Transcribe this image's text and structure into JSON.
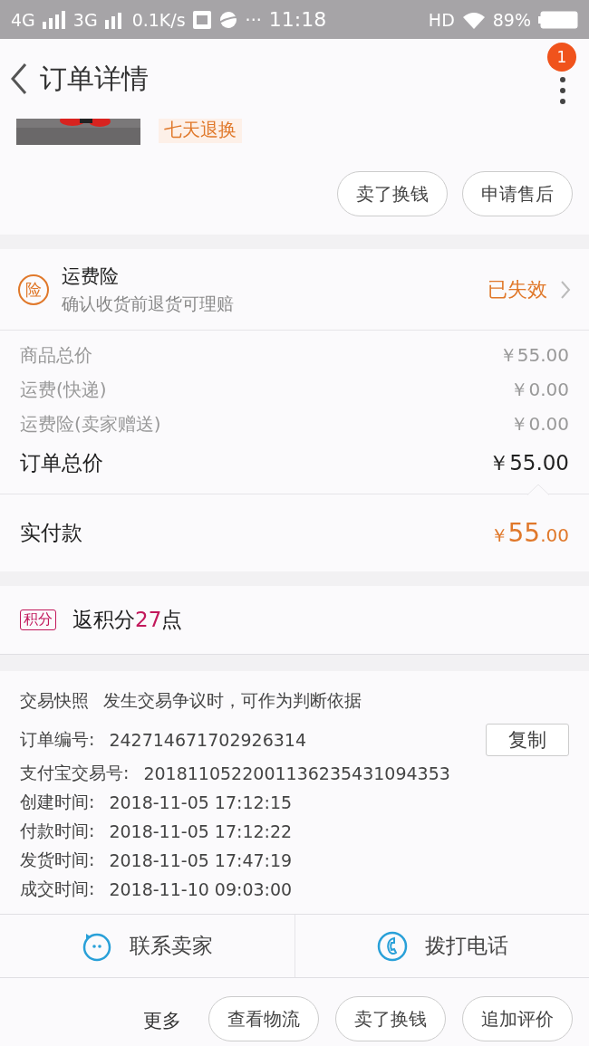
{
  "status_bar": {
    "network_1": "4G",
    "network_2": "3G",
    "speed": "0.1K/s",
    "more": "···",
    "time": "11:18",
    "hd": "HD",
    "battery": "89%"
  },
  "header": {
    "title": "订单详情",
    "badge": "1"
  },
  "product": {
    "tag": "七天退换"
  },
  "product_buttons": [
    "卖了换钱",
    "申请售后"
  ],
  "insurance": {
    "badge": "险",
    "title": "运费险",
    "subtitle": "确认收货前退货可理赔",
    "status": "已失效"
  },
  "price_rows": [
    {
      "label": "商品总价",
      "value": "￥55.00",
      "kind": "minor"
    },
    {
      "label": "运费(快递)",
      "value": "￥0.00",
      "kind": "minor"
    },
    {
      "label": "运费险(卖家赠送)",
      "value": "￥0.00",
      "kind": "minor"
    },
    {
      "label": "订单总价",
      "value": "￥55.00",
      "kind": "total"
    }
  ],
  "paid": {
    "label": "实付款",
    "currency": "￥",
    "amount": "55",
    "cents": ".00"
  },
  "points": {
    "badge": "积分",
    "text": "返积分**27**点"
  },
  "info": {
    "snapshot_label": "交易快照",
    "snapshot_text": "发生交易争议时，可作为判断依据",
    "rows": [
      {
        "label": "订单编号:",
        "value": "242714671702926314",
        "copy": "复制"
      },
      {
        "label": "支付宝交易号:",
        "value": "2018110522001136235431094353"
      },
      {
        "label": "创建时间:",
        "value": "2018-11-05 17:12:15"
      },
      {
        "label": "付款时间:",
        "value": "2018-11-05 17:12:22"
      },
      {
        "label": "发货时间:",
        "value": "2018-11-05 17:47:19"
      },
      {
        "label": "成交时间:",
        "value": "2018-11-10 09:03:00"
      }
    ]
  },
  "contact": [
    {
      "label": "联系卖家",
      "kind": "chat"
    },
    {
      "label": "拨打电话",
      "kind": "phone"
    }
  ],
  "bottom_bar": {
    "more": "更多",
    "buttons": [
      "查看物流",
      "卖了换钱",
      "追加评价"
    ]
  }
}
